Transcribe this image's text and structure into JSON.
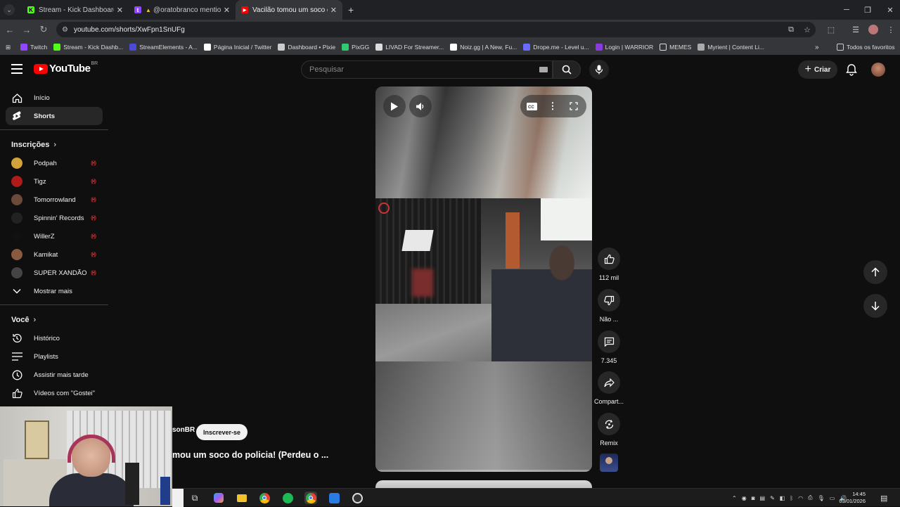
{
  "browser": {
    "tabs": [
      {
        "title": "Stream - Kick Dashboard",
        "icon": "kick-icon"
      },
      {
        "title": "@oratobranco mentioned y",
        "icon": "twitch-icon"
      },
      {
        "title": "Vacilão tomou um soco do polí",
        "icon": "youtube-icon"
      }
    ],
    "url": "youtube.com/shorts/XwFpn1SnUFg",
    "bookmarks": [
      {
        "label": "Twitch",
        "icon": "twitch-icon",
        "color": "#9146ff"
      },
      {
        "label": "Stream - Kick Dashb...",
        "icon": "kick-icon",
        "color": "#53fc18"
      },
      {
        "label": "StreamElements - A...",
        "icon": "streamelements-icon",
        "color": "#4a49d8"
      },
      {
        "label": "Página Inicial / Twitter",
        "icon": "x-icon",
        "color": "#ffffff"
      },
      {
        "label": "Dashboard • Pixie",
        "icon": "pixie-icon",
        "color": "#cccccc"
      },
      {
        "label": "PixGG",
        "icon": "pixgg-icon",
        "color": "#2ecc71"
      },
      {
        "label": "LIVAD For Streamer...",
        "icon": "livad-icon",
        "color": "#dddddd"
      },
      {
        "label": "Noiz.gg | A New, Fu...",
        "icon": "noiz-icon",
        "color": "#ffffff"
      },
      {
        "label": "Drope.me - Level u...",
        "icon": "drope-icon",
        "color": "#6b6bff"
      },
      {
        "label": "Login | WARRIOR",
        "icon": "warrior-icon",
        "color": "#8a3ae0"
      },
      {
        "label": "MEMES",
        "icon": "folder-icon",
        "color": "#dddddd"
      },
      {
        "label": "Myrient | Content Li...",
        "icon": "myrient-icon",
        "color": "#aaaaaa"
      }
    ],
    "bookmarks_all": "Todos os favoritos"
  },
  "youtube": {
    "logo_text": "YouTube",
    "country": "BR",
    "search_placeholder": "Pesquisar",
    "create_label": "Criar"
  },
  "sidebar": {
    "main": [
      {
        "label": "Início",
        "icon": "home-icon"
      },
      {
        "label": "Shorts",
        "icon": "shorts-icon",
        "active": true
      }
    ],
    "subs_heading": "Inscrições",
    "subscriptions": [
      {
        "label": "Podpah",
        "color": "#d4a23a"
      },
      {
        "label": "Tigz",
        "color": "#b11a1a"
      },
      {
        "label": "Tomorrowland",
        "color": "#6b4a3a"
      },
      {
        "label": "Spinnin' Records",
        "color": "#222222"
      },
      {
        "label": "WillerZ",
        "color": "#111111"
      },
      {
        "label": "Kamikat",
        "color": "#8a5a40"
      },
      {
        "label": "SUPER XANDÃO",
        "color": "#444444"
      }
    ],
    "show_more": "Mostrar mais",
    "you_heading": "Você",
    "you": [
      {
        "label": "Histórico",
        "icon": "history-icon"
      },
      {
        "label": "Playlists",
        "icon": "playlists-icon"
      },
      {
        "label": "Assistir mais tarde",
        "icon": "watch-later-icon"
      },
      {
        "label": "Vídeos com \"Gostei\"",
        "icon": "liked-icon"
      }
    ]
  },
  "short": {
    "channel": "sonBR",
    "subscribe": "Inscrever-se",
    "title": "mou um soco do policia! (Perdeu o ..."
  },
  "actions": {
    "likes": "112 mil",
    "dislike": "Não ...",
    "comments": "7.345",
    "share": "Compart...",
    "remix": "Remix"
  },
  "taskbar": {
    "time": "14:45",
    "date": "03/01/2026"
  }
}
